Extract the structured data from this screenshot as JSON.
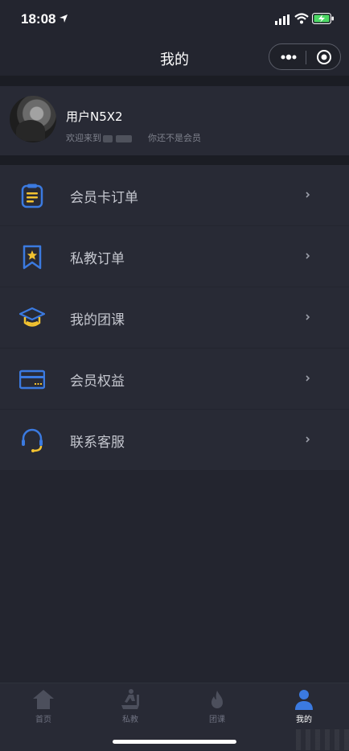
{
  "status": {
    "time": "18:08"
  },
  "nav": {
    "title": "我的"
  },
  "profile": {
    "username": "用户N5X2",
    "welcome_prefix": "欢迎来到",
    "member_status": "你还不是会员"
  },
  "menu": [
    {
      "label": "会员卡订单",
      "icon": "clipboard-icon"
    },
    {
      "label": "私教订单",
      "icon": "bookmark-star-icon"
    },
    {
      "label": "我的团课",
      "icon": "graduation-cap-icon"
    },
    {
      "label": "会员权益",
      "icon": "card-icon"
    },
    {
      "label": "联系客服",
      "icon": "headset-icon"
    }
  ],
  "tabs": [
    {
      "label": "首页",
      "icon": "home-icon"
    },
    {
      "label": "私教",
      "icon": "treadmill-icon"
    },
    {
      "label": "团课",
      "icon": "flame-icon"
    },
    {
      "label": "我的",
      "icon": "user-icon"
    }
  ],
  "colors": {
    "background": "#23252f",
    "card": "#282a35",
    "accent_blue": "#3b7ae0",
    "accent_yellow": "#f2c230"
  }
}
